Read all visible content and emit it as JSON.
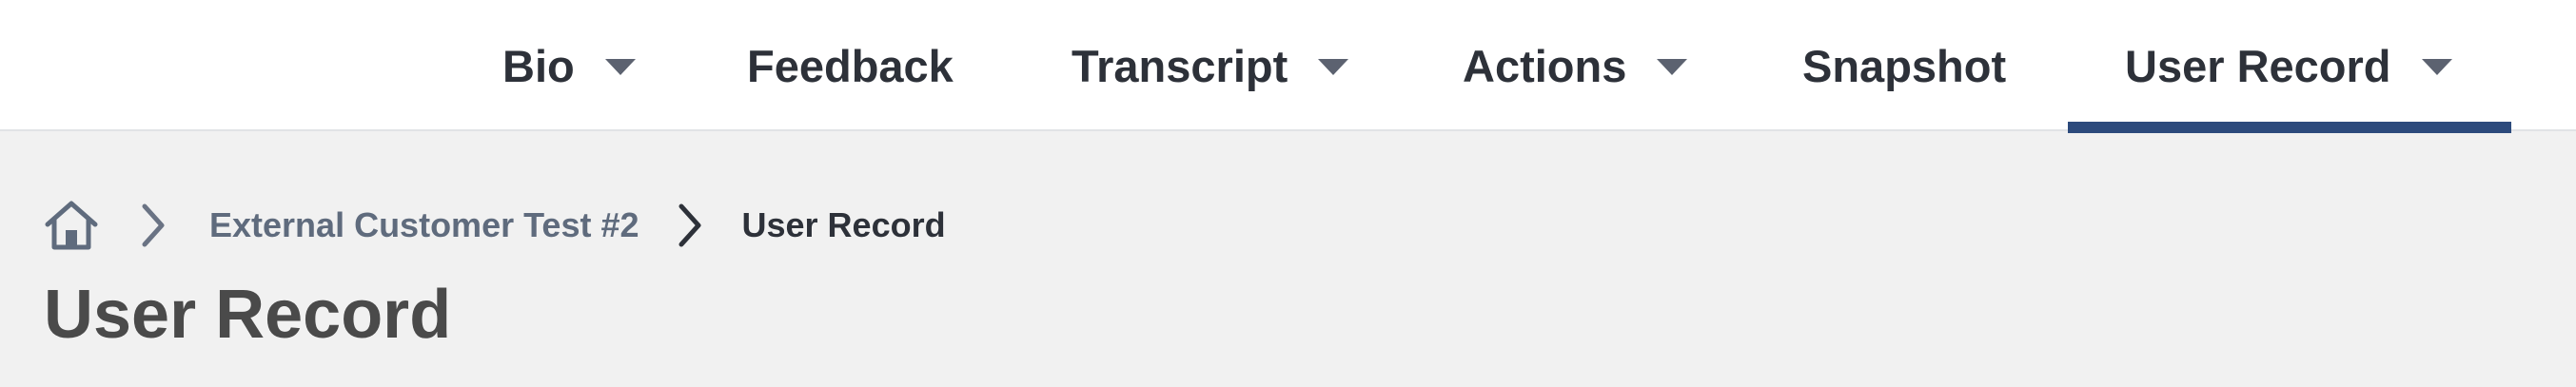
{
  "nav": {
    "items": [
      {
        "label": "Bio",
        "has_dropdown": true,
        "active": false
      },
      {
        "label": "Feedback",
        "has_dropdown": false,
        "active": false
      },
      {
        "label": "Transcript",
        "has_dropdown": true,
        "active": false
      },
      {
        "label": "Actions",
        "has_dropdown": true,
        "active": false
      },
      {
        "label": "Snapshot",
        "has_dropdown": false,
        "active": false
      },
      {
        "label": "User Record",
        "has_dropdown": true,
        "active": true
      }
    ],
    "active_color": "#2c4a7c"
  },
  "breadcrumb": {
    "home_icon": "home-icon",
    "parent_label": "External Customer Test #2",
    "current_label": "User Record"
  },
  "page": {
    "title": "User Record"
  }
}
